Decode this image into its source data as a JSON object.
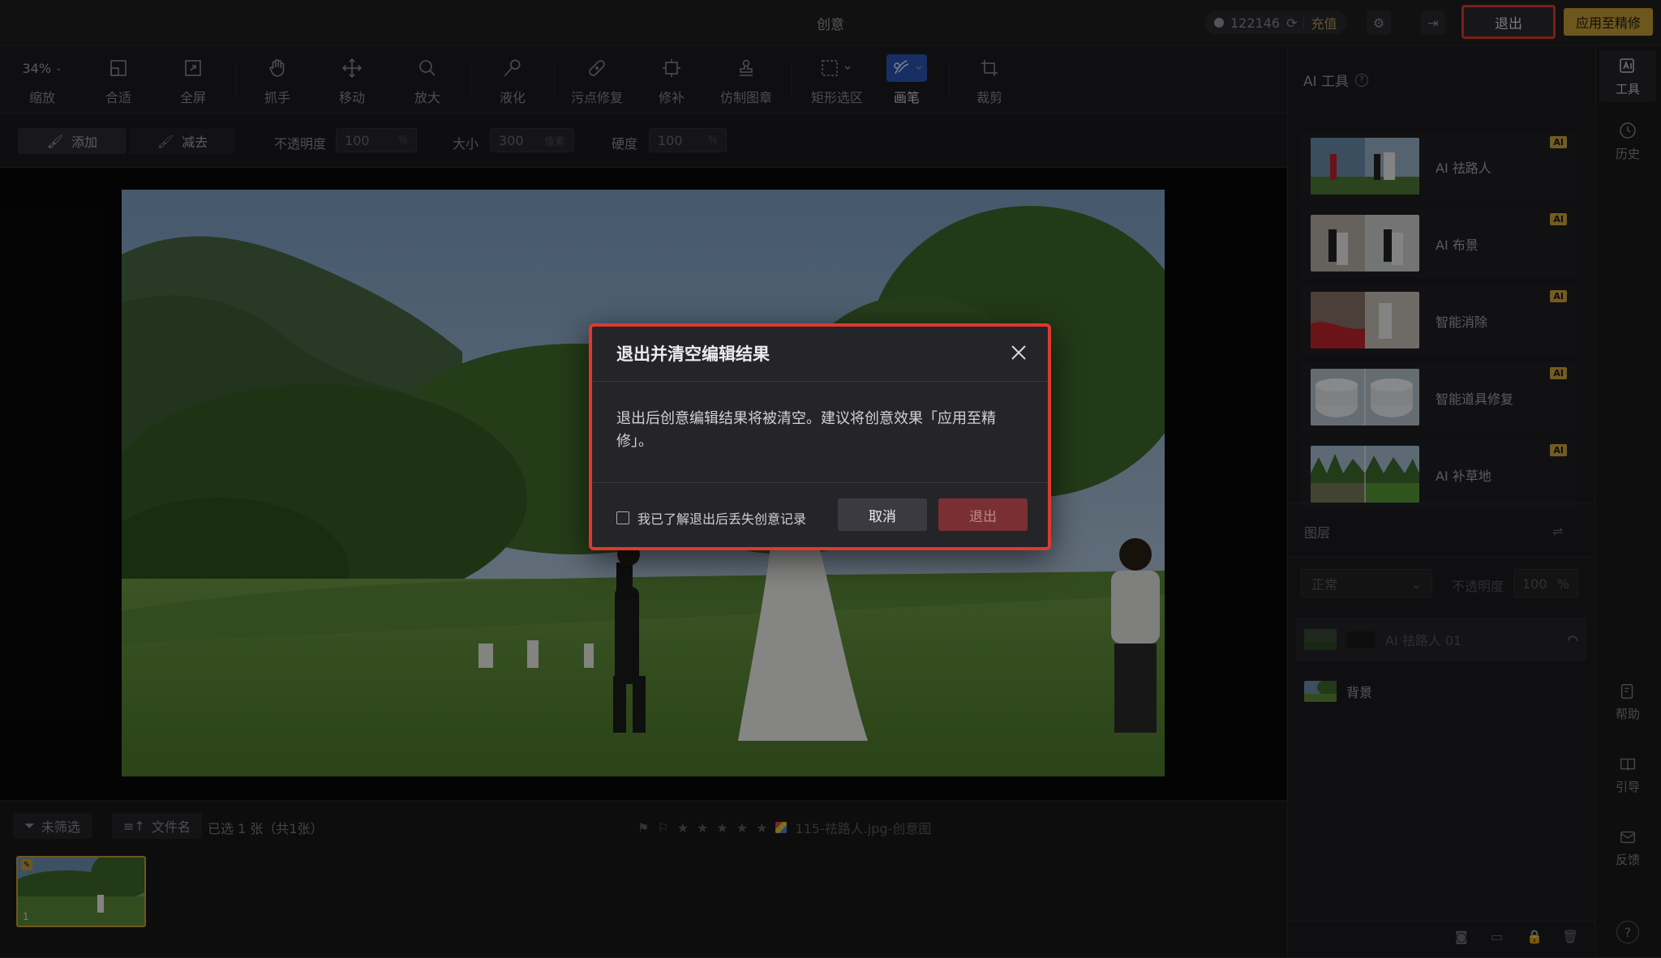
{
  "app": {
    "title": "创意"
  },
  "topbar": {
    "credits": "122146",
    "recharge": "充值",
    "exit": "退出",
    "apply": "应用至精修"
  },
  "toolbar": {
    "zoom": "34%",
    "tools": [
      {
        "label": "缩放"
      },
      {
        "label": "合适"
      },
      {
        "label": "全屏"
      },
      {
        "label": "抓手"
      },
      {
        "label": "移动"
      },
      {
        "label": "放大"
      },
      {
        "label": "液化"
      },
      {
        "label": "污点修复"
      },
      {
        "label": "修补"
      },
      {
        "label": "仿制图章"
      },
      {
        "label": "矩形选区"
      },
      {
        "label": "画笔"
      },
      {
        "label": "裁剪"
      }
    ]
  },
  "options": {
    "add": "添加",
    "subtract": "减去",
    "opacity_label": "不透明度",
    "opacity_value": "100",
    "opacity_unit": "%",
    "size_label": "大小",
    "size_value": "300",
    "size_unit": "像素",
    "hardness_label": "硬度",
    "hardness_value": "100",
    "hardness_unit": "%"
  },
  "filmstrip": {
    "filter": "未筛选",
    "sort": "文件名",
    "selection": "已选 1 张（共1张）",
    "filename": "115-祛路人.jpg-创意图",
    "thumb_index": "1"
  },
  "right_panel": {
    "ai_title": "AI 工具",
    "ai_badge": "AI",
    "ai_tools": [
      {
        "name": "AI 祛路人"
      },
      {
        "name": "AI 布景"
      },
      {
        "name": "智能消除"
      },
      {
        "name": "智能道具修复"
      },
      {
        "name": "AI 补草地"
      }
    ],
    "layers_title": "图层",
    "blend_mode": "正常",
    "layer_opacity_label": "不透明度",
    "layer_opacity_value": "100",
    "layer_opacity_unit": "%",
    "layers": [
      {
        "name": "AI 祛路人 01"
      },
      {
        "name": "背景"
      }
    ]
  },
  "rail": {
    "tools": "工具",
    "history": "历史",
    "help": "帮助",
    "guide": "引导",
    "feedback": "反馈",
    "question": "?"
  },
  "dialog": {
    "title": "退出并清空编辑结果",
    "body": "退出后创意编辑结果将被清空。建议将创意效果「应用至精修」。",
    "checkbox": "我已了解退出后丢失创意记录",
    "cancel": "取消",
    "confirm": "退出"
  },
  "colors": {
    "accent_gold": "#c79f36",
    "highlight_red": "#e0382f",
    "active_tool_blue": "#2d57b8"
  }
}
